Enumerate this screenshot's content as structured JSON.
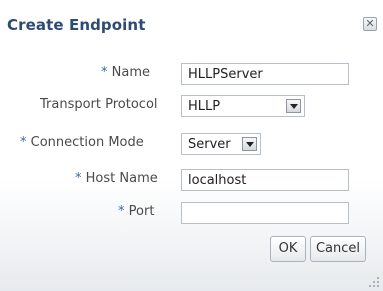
{
  "dialog": {
    "title": "Create Endpoint",
    "close_icon": "close-icon"
  },
  "form": {
    "required_marker": "*",
    "name": {
      "label": "Name",
      "value": "HLLPServer",
      "required": true
    },
    "transport_protocol": {
      "label": "Transport Protocol",
      "value": "HLLP",
      "required": false
    },
    "connection_mode": {
      "label": "Connection Mode",
      "value": "Server",
      "required": true
    },
    "host_name": {
      "label": "Host Name",
      "value": "localhost",
      "required": true
    },
    "port": {
      "label": "Port",
      "value": "",
      "required": true
    }
  },
  "buttons": {
    "ok": "OK",
    "cancel": "Cancel"
  },
  "colors": {
    "title": "#2d4b75",
    "required_marker": "#3a69a1",
    "label": "#4a4a4a"
  }
}
